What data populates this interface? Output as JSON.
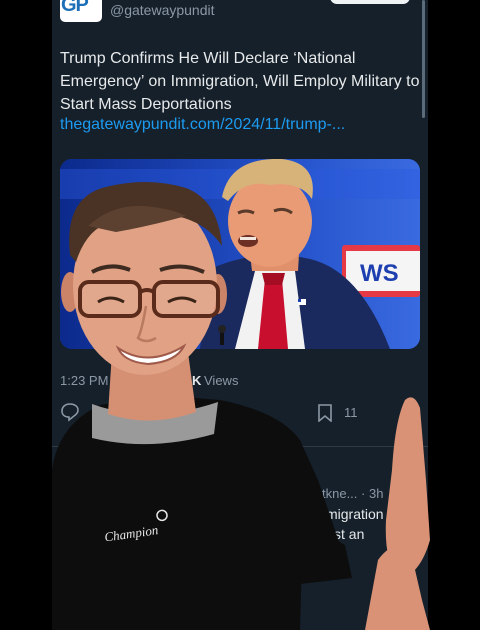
{
  "tweet": {
    "logo_text": "GP",
    "handle": "@gatewaypundit",
    "text": "Trump Confirms He Will Declare ‘National Emergency’ on Immigration, Will Employ Military to Start Mass Deportations",
    "link": "thegatewaypundit.com/2024/11/trump-...",
    "media_banner_text": "WS",
    "time": "1:23 PM",
    "views_count": "K",
    "views_label": "Views",
    "bookmark_count": "11"
  },
  "reply_preview": {
    "meta": "tkne... · 3h",
    "line1": "migration i",
    "line2": "st an"
  },
  "shirt": {
    "brand_text": "Champion"
  },
  "colors": {
    "background": "#15202b",
    "text": "#e7e9ea",
    "muted": "#8b98a5",
    "link": "#1d9bf0",
    "tie": "#c8102e"
  }
}
